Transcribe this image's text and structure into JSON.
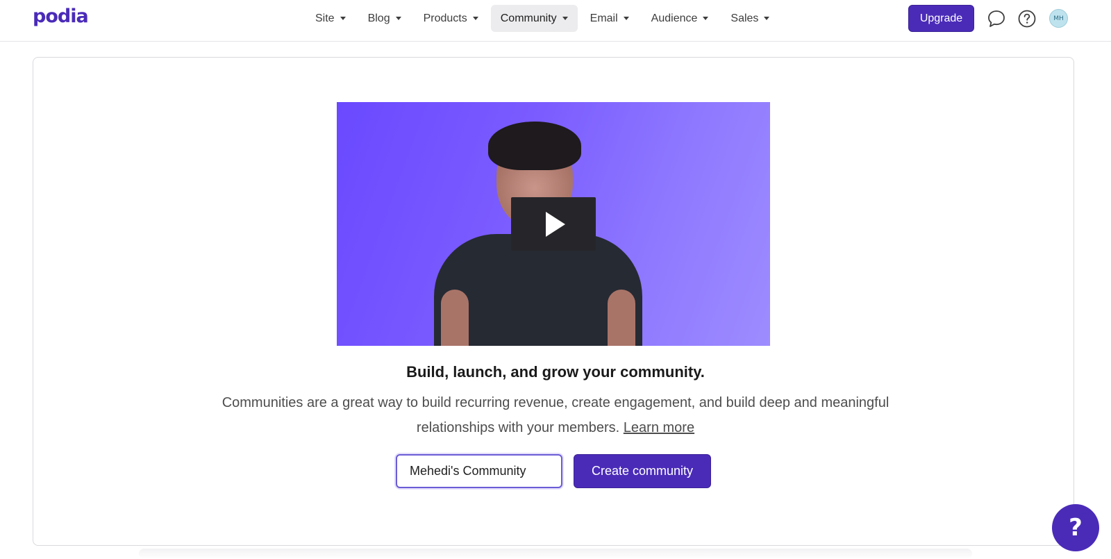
{
  "header": {
    "logo": "podia",
    "nav": [
      {
        "label": "Site"
      },
      {
        "label": "Blog"
      },
      {
        "label": "Products"
      },
      {
        "label": "Community",
        "active": true
      },
      {
        "label": "Email"
      },
      {
        "label": "Audience"
      },
      {
        "label": "Sales"
      }
    ],
    "upgrade_label": "Upgrade",
    "chat_icon": "chat-bubble-icon",
    "help_icon": "question-circle-icon",
    "avatar_initials": "MH"
  },
  "main": {
    "video": {
      "play_icon": "play-icon"
    },
    "headline": "Build, launch, and grow your community.",
    "description": "Communities are a great way to build recurring revenue, create engagement, and build deep and meaningful relationships with your members.",
    "learn_more": "Learn more",
    "community_name_value": "Mehedi's Community",
    "create_button": "Create community"
  },
  "floating_help": {
    "label": "?"
  },
  "colors": {
    "brand": "#4a2bb8",
    "nav_active_bg": "#ececee"
  }
}
